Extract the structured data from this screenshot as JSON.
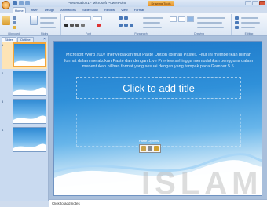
{
  "window": {
    "title": "Presentation1 - Microsoft PowerPoint",
    "context_tab": "Drawing Tools"
  },
  "ribbon": {
    "tabs": [
      "Home",
      "Insert",
      "Design",
      "Animations",
      "Slide Show",
      "Review",
      "View",
      "Format"
    ],
    "active_tab": "Home",
    "groups": [
      "Clipboard",
      "Slides",
      "Font",
      "Paragraph",
      "Drawing",
      "Editing"
    ]
  },
  "left_panel": {
    "tabs": [
      "Slides",
      "Outline"
    ],
    "active_tab": "Slides",
    "slides": [
      {
        "number": "1"
      },
      {
        "number": "2"
      },
      {
        "number": "3"
      },
      {
        "number": "4"
      }
    ]
  },
  "slide": {
    "title": "Click to add title",
    "body": "Microsoft Word 2007 menyediakan fitur Paste Option (pilihan Paste). Fitur ini memberikan pilihan format dalam melakukan Paste dan dengan Live Preview sehingga memudahkan pengguna dalam menentukan pilihan format yang sesuai dengan yang tampak pada Gambar 5.5.",
    "paste_label": "Paste Options"
  },
  "notes": {
    "placeholder": "Click to add notes"
  },
  "watermark": "ISLAM",
  "colors": {
    "slide_top": "#1c78c9",
    "slide_bottom": "#ffffff",
    "selected_thumb": "#f3a63a",
    "ribbon": "#dbe6f4"
  }
}
